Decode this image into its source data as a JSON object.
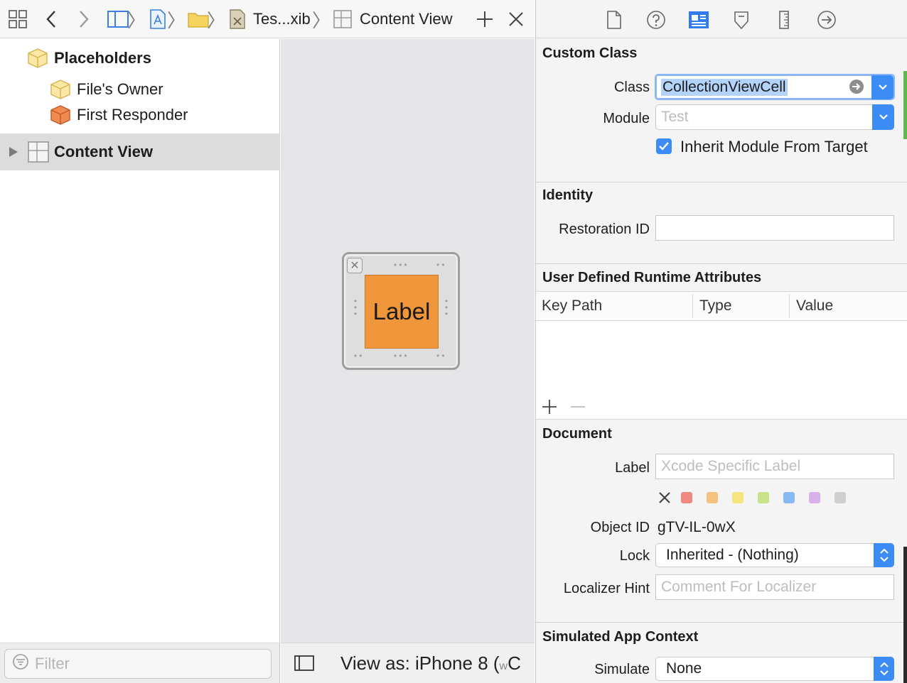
{
  "jumpbar": {
    "file_label": "Tes...xib",
    "object_label": "Content View"
  },
  "outline": {
    "placeholders_label": "Placeholders",
    "files_owner_label": "File's Owner",
    "first_responder_label": "First Responder",
    "content_view_label": "Content View",
    "filter_placeholder": "Filter"
  },
  "canvas": {
    "cell_label": "Label",
    "view_as_label": "View as: iPhone 8 (",
    "view_as_w": "w",
    "view_as_c": "C"
  },
  "inspector": {
    "custom_class": {
      "title": "Custom Class",
      "class_label": "Class",
      "class_value": "CollectionViewCell",
      "module_label": "Module",
      "module_placeholder": "Test",
      "inherit_label": "Inherit Module From Target",
      "inherit_checked": true
    },
    "identity": {
      "title": "Identity",
      "restoration_label": "Restoration ID",
      "restoration_value": ""
    },
    "runtime_attributes": {
      "title": "User Defined Runtime Attributes",
      "columns": [
        "Key Path",
        "Type",
        "Value"
      ]
    },
    "document": {
      "title": "Document",
      "label_label": "Label",
      "label_placeholder": "Xcode Specific Label",
      "swatch_colors": [
        "#f08a80",
        "#f5c27f",
        "#f5e47f",
        "#c9e28a",
        "#86b9f5",
        "#d9b0ea",
        "#cfcfcf"
      ],
      "object_id_label": "Object ID",
      "object_id_value": "gTV-IL-0wX",
      "lock_label": "Lock",
      "lock_value": "Inherited - (Nothing)",
      "localizer_label": "Localizer Hint",
      "localizer_placeholder": "Comment For Localizer"
    },
    "simulated": {
      "title": "Simulated App Context",
      "simulate_label": "Simulate",
      "simulate_value": "None"
    }
  },
  "colors": {
    "accent": "#3c8cf5",
    "label_fill": "#f0963a",
    "selection_bg": "#dcdcdc"
  }
}
